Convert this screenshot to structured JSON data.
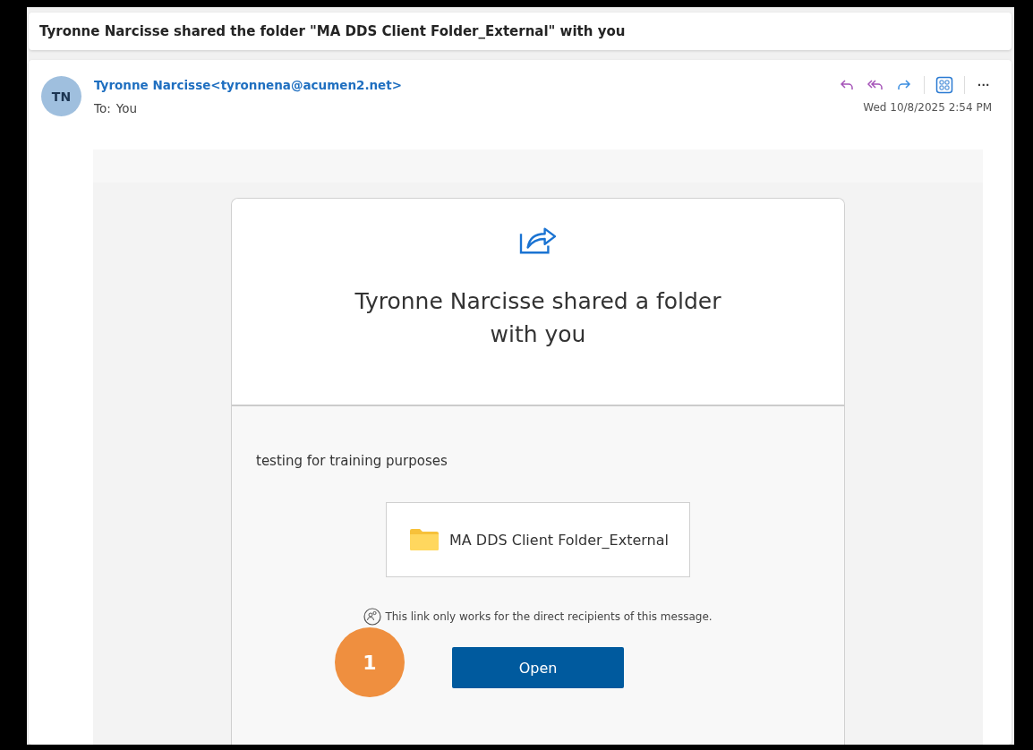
{
  "subject": "Tyronne Narcisse shared the folder \"MA DDS Client Folder_External\" with you",
  "message": {
    "avatar_initials": "TN",
    "sender": "Tyronne Narcisse<tyronnena@acumen2.net>",
    "to_label": "To:",
    "to": "You",
    "date": "Wed 10/8/2025 2:54 PM",
    "more": "···"
  },
  "share_card": {
    "heading": "Tyronne Narcisse shared a folder with you",
    "note": "testing for training purposes",
    "folder_name": "MA DDS Client Folder_External",
    "notice": "This link only works for the direct recipients of this message.",
    "button": "Open"
  },
  "callout": {
    "number": "1"
  }
}
